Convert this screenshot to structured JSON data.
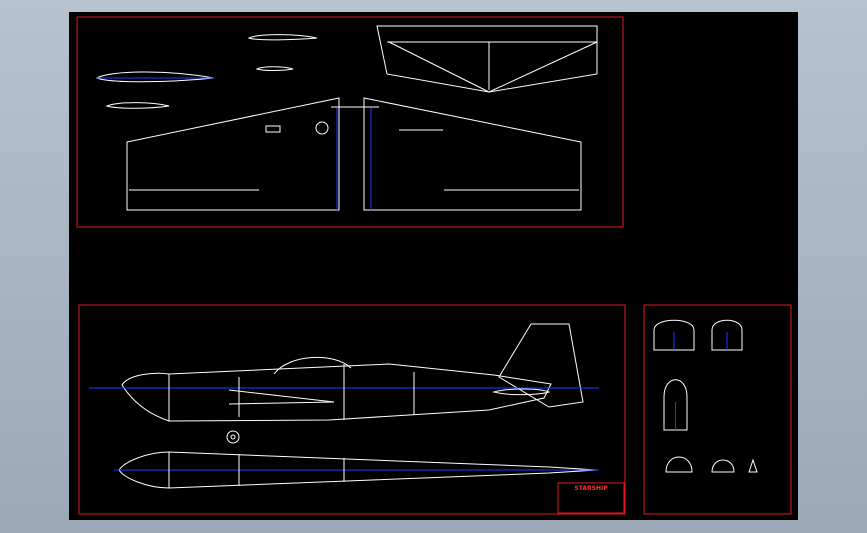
{
  "title_block": {
    "title": "STARSHIP",
    "lines": [
      "",
      "",
      "",
      "",
      ""
    ]
  },
  "colors": {
    "background": "#000000",
    "frame": "#e01818",
    "outline": "#ffffff",
    "centerline": "#1a3cff"
  }
}
